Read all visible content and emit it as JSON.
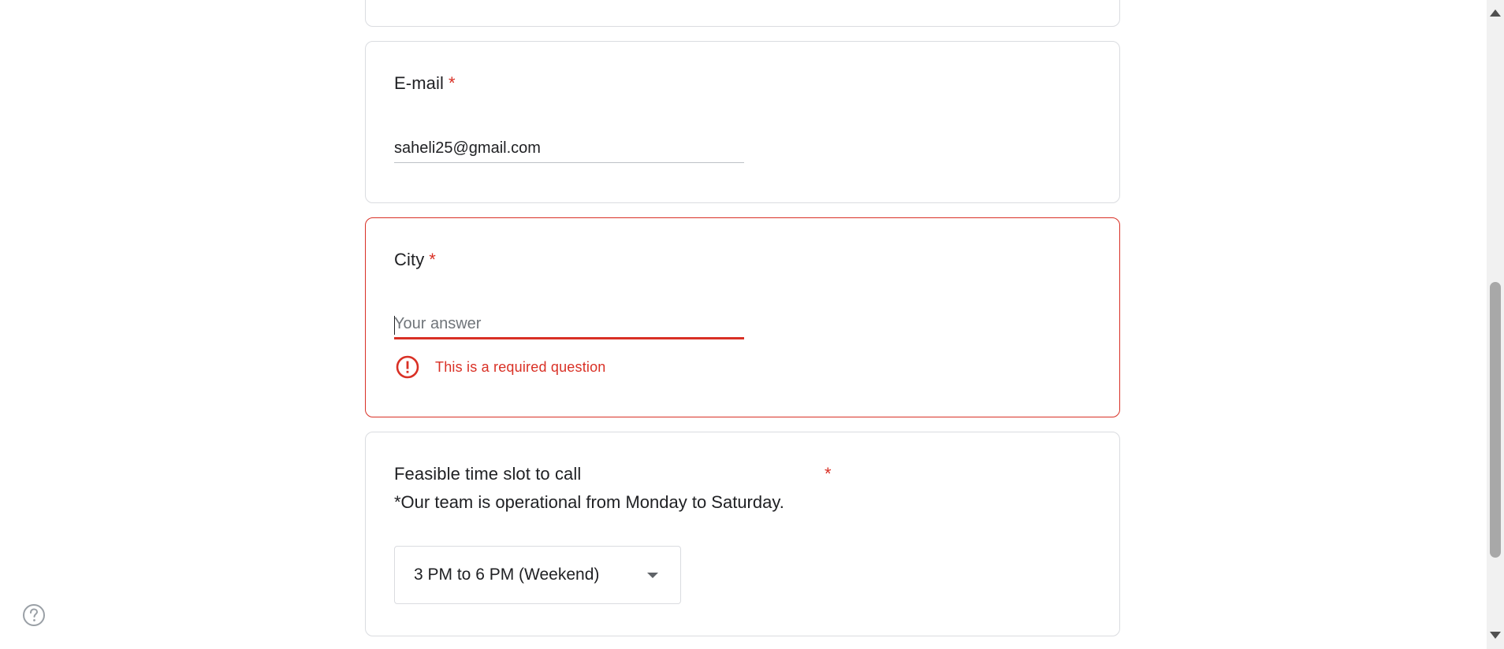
{
  "form": {
    "email": {
      "title": "E-mail",
      "required_mark": "*",
      "value": "saheli25@gmail.com"
    },
    "city": {
      "title": "City",
      "required_mark": "*",
      "placeholder": "Your answer",
      "error_message": "This is a required question"
    },
    "time_slot": {
      "title": "Feasible time slot to call",
      "required_mark": "*",
      "description": "*Our team is operational from Monday to Saturday.",
      "selected_value": "3 PM to 6 PM (Weekend)"
    }
  },
  "icons": {
    "error": "error-circle-icon",
    "dropdown": "dropdown-arrow-icon",
    "help": "help-circle-icon"
  },
  "colors": {
    "error": "#d93025",
    "border": "#dadce0",
    "text": "#202124"
  }
}
